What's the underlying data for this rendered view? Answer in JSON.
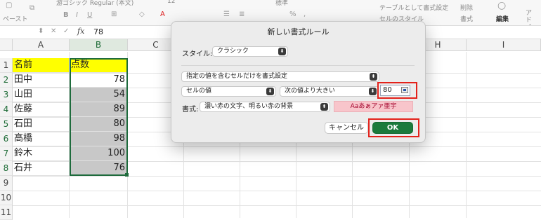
{
  "ribbon": {
    "paste_label": "ペースト",
    "font_name": "游ゴシック Regular (本文)",
    "font_size": "12",
    "number_format": "標準",
    "format_as_table": "テーブルとして書式設定",
    "cell_styles": "セルのスタイル",
    "delete_label": "削除",
    "format_label": "書式",
    "edit_label": "編集",
    "addin_label": "アド イン"
  },
  "formula_bar": {
    "cell_ref": "",
    "fx": "fx",
    "value": "78"
  },
  "sheet": {
    "columns": [
      "A",
      "B",
      "C",
      "D",
      "E",
      "F",
      "G",
      "H",
      "I"
    ],
    "rows": [
      "1",
      "2",
      "3",
      "4",
      "5",
      "6",
      "7",
      "8",
      "9",
      "10",
      "11"
    ],
    "data": [
      {
        "name": "名前",
        "score": "点数"
      },
      {
        "name": "田中",
        "score": "78"
      },
      {
        "name": "山田",
        "score": "54"
      },
      {
        "name": "佐藤",
        "score": "89"
      },
      {
        "name": "石田",
        "score": "80"
      },
      {
        "name": "高橋",
        "score": "98"
      },
      {
        "name": "鈴木",
        "score": "100"
      },
      {
        "name": "石井",
        "score": "76"
      }
    ]
  },
  "dialog": {
    "title": "新しい書式ルール",
    "style_label": "スタイル:",
    "style_value": "クラシック",
    "rule_type": "指定の値を含むセルだけを書式設定",
    "condition_subject": "セルの値",
    "operator": "次の値より大きい",
    "value": "80",
    "format_label": "書式:",
    "format_value": "濃い赤の文字、明るい赤の背景",
    "preview_text": "Aaあぁアァ亜宇",
    "cancel_label": "キャンセル",
    "ok_label": "OK"
  },
  "colors": {
    "header_fill": "#ffff00",
    "highlight_fill": "#c8c8c8",
    "selection_border": "#1e6b3c",
    "ok_button": "#1b7a3c",
    "annotation_red": "#e3221b",
    "preview_bg": "#f8c5cb",
    "preview_text": "#a3002a"
  }
}
